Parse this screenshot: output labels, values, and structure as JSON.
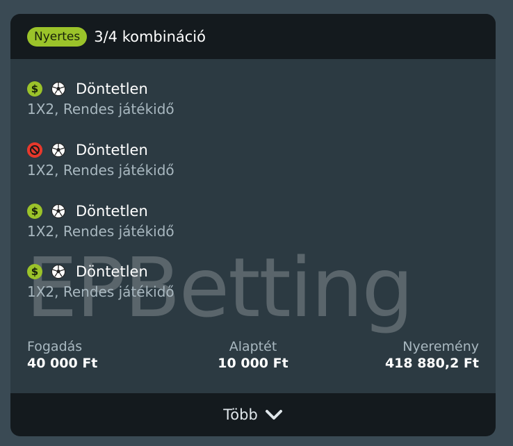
{
  "header": {
    "badge": "Nyertes",
    "title": "3/4 kombináció"
  },
  "watermark": "EPBetting",
  "selections": [
    {
      "status": "won",
      "status_glyph": "$",
      "icon": "soccer-ball-icon",
      "name": "Döntetlen",
      "market": "1X2, Rendes játékidő"
    },
    {
      "status": "lost",
      "status_glyph": "",
      "icon": "soccer-ball-icon",
      "name": "Döntetlen",
      "market": "1X2, Rendes játékidő"
    },
    {
      "status": "won",
      "status_glyph": "$",
      "icon": "soccer-ball-icon",
      "name": "Döntetlen",
      "market": "1X2, Rendes játékidő"
    },
    {
      "status": "won",
      "status_glyph": "$",
      "icon": "soccer-ball-icon",
      "name": "Döntetlen",
      "market": "1X2, Rendes játékidő"
    }
  ],
  "stats": {
    "stake_label": "Fogadás",
    "stake_value": "40 000 Ft",
    "base_label": "Alaptét",
    "base_value": "10 000 Ft",
    "win_label": "Nyeremény",
    "win_value": "418 880,2 Ft"
  },
  "footer": {
    "more_label": "Több",
    "more_icon": "chevron-down-icon"
  },
  "colors": {
    "win": "#9bc32a",
    "lost": "#e8382c",
    "header_bg": "#141a1e",
    "card_bg": "#2c3a42"
  }
}
